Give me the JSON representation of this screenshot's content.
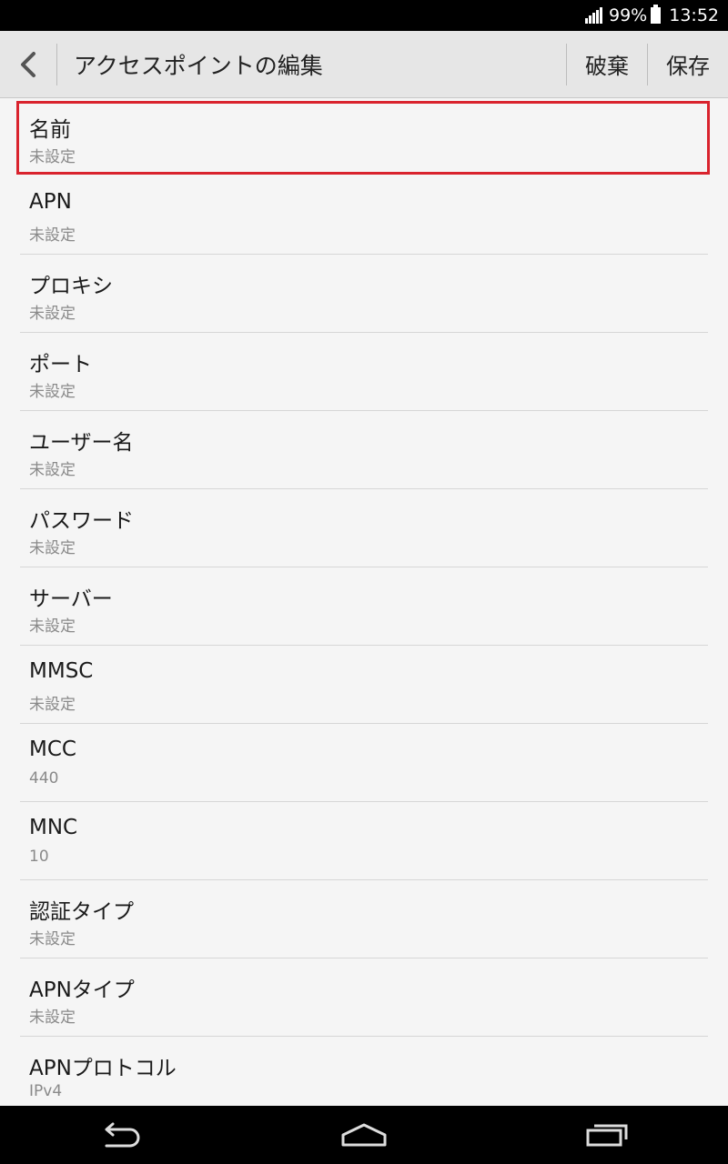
{
  "status_bar": {
    "battery_percent": "99%",
    "time": "13:52"
  },
  "action_bar": {
    "title": "アクセスポイントの編集",
    "discard_label": "破棄",
    "save_label": "保存"
  },
  "settings": [
    {
      "label": "名前",
      "value": "未設定"
    },
    {
      "label": "APN",
      "value": "未設定"
    },
    {
      "label": "プロキシ",
      "value": "未設定"
    },
    {
      "label": "ポート",
      "value": "未設定"
    },
    {
      "label": "ユーザー名",
      "value": "未設定"
    },
    {
      "label": "パスワード",
      "value": "未設定"
    },
    {
      "label": "サーバー",
      "value": "未設定"
    },
    {
      "label": "MMSC",
      "value": "未設定"
    },
    {
      "label": "MCC",
      "value": "440"
    },
    {
      "label": "MNC",
      "value": "10"
    },
    {
      "label": "認証タイプ",
      "value": "未設定"
    },
    {
      "label": "APNタイプ",
      "value": "未設定"
    },
    {
      "label": "APNプロトコル",
      "value": "IPv4"
    }
  ],
  "colors": {
    "highlight": "#d9232d"
  },
  "icons": {
    "back": "chevron-left-icon",
    "nav_back": "back-arrow-icon",
    "nav_home": "home-icon",
    "nav_recents": "recents-icon"
  }
}
